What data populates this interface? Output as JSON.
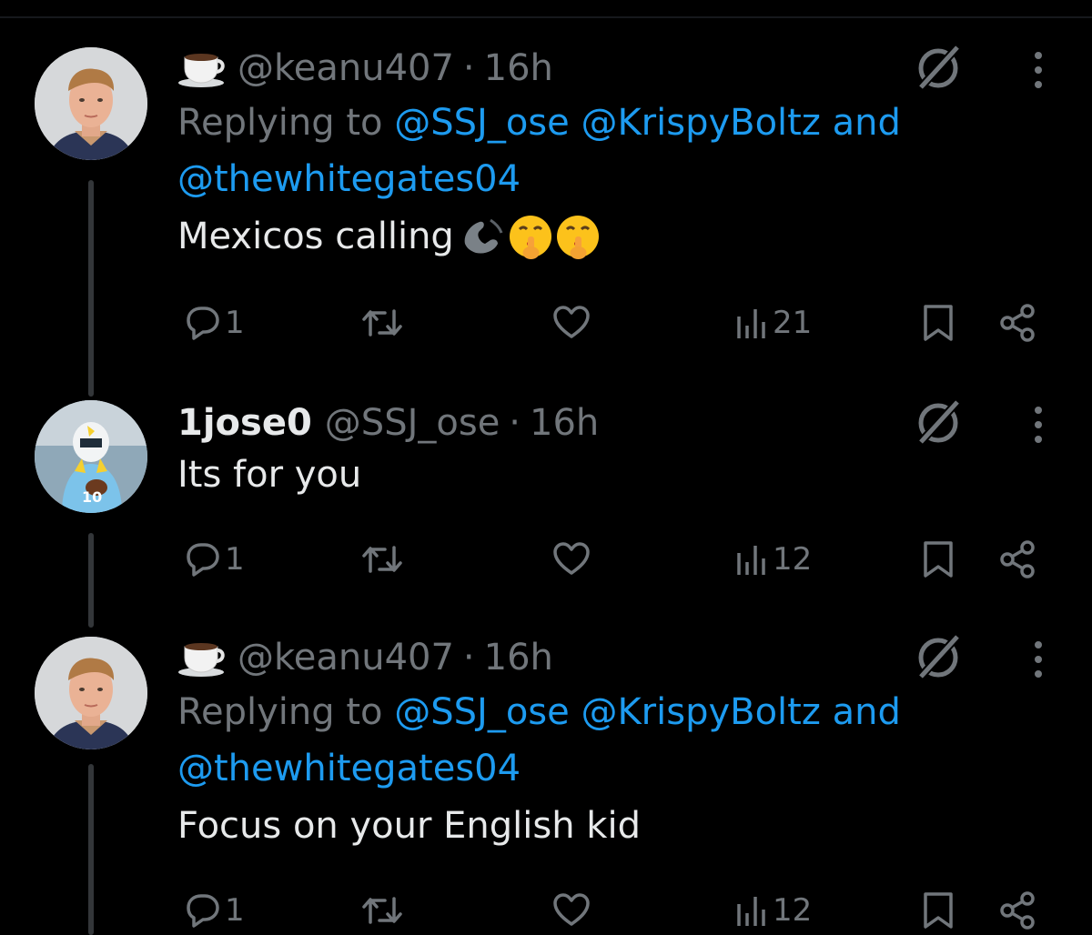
{
  "tweets": [
    {
      "display_name": "",
      "name_emoji": "coffee-cup",
      "handle": "@keanu407",
      "time": "16h",
      "replying_prefix": "Replying to",
      "replying_line1_mentions": [
        "@SSJ_ose",
        "@KrispyBoltz"
      ],
      "replying_and": "and",
      "replying_line2_mention": "@thewhitegates04",
      "text": "Mexicos calling",
      "text_emojis": [
        "telephone-receiver",
        "shushing-face",
        "shushing-face"
      ],
      "replies": "1",
      "views": "21"
    },
    {
      "display_name": "1jose0",
      "handle": "@SSJ_ose",
      "time": "16h",
      "text": "Its for you",
      "replies": "1",
      "views": "12"
    },
    {
      "display_name": "",
      "name_emoji": "coffee-cup",
      "handle": "@keanu407",
      "time": "16h",
      "replying_prefix": "Replying to",
      "replying_line1_mentions": [
        "@SSJ_ose",
        "@KrispyBoltz"
      ],
      "replying_and": "and",
      "replying_line2_mention": "@thewhitegates04",
      "text": "Focus on your English kid",
      "replies": "1",
      "views": "12"
    }
  ],
  "separator": "·",
  "colors": {
    "background": "#000000",
    "text_primary": "#e7e9ea",
    "text_secondary": "#71767b",
    "link": "#1d9bf0",
    "thread_line": "#333639"
  },
  "icons": {
    "reply": "reply-icon",
    "retweet": "retweet-icon",
    "like": "heart-icon",
    "views": "views-icon",
    "bookmark": "bookmark-icon",
    "share": "share-icon",
    "grok": "grok-icon",
    "more": "more-icon"
  }
}
